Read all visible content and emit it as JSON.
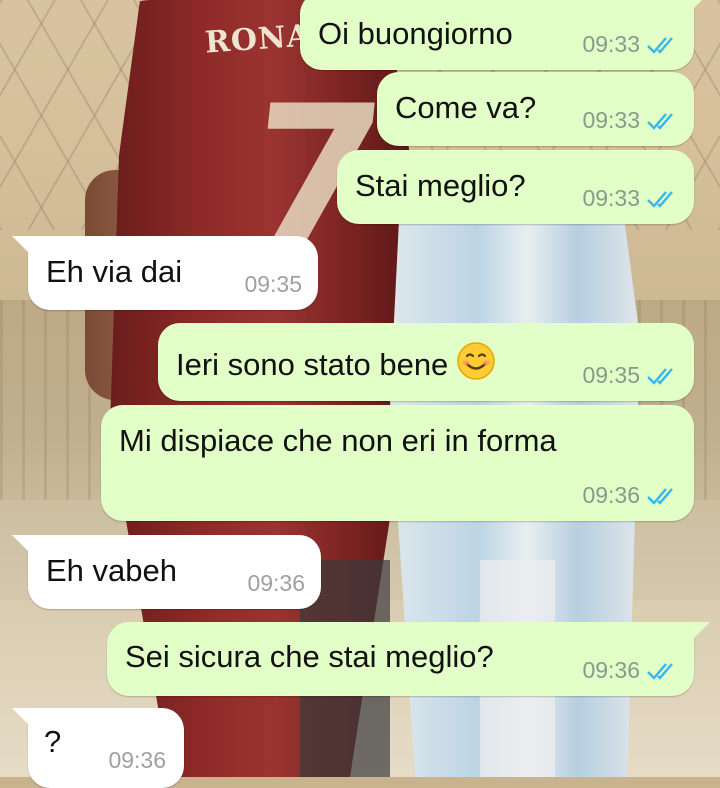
{
  "wallpaper": {
    "jersey_name": "RONA",
    "jersey_number": "7"
  },
  "colors": {
    "outgoing_bubble": "#e2ffc7",
    "incoming_bubble": "#ffffff",
    "read_ticks": "#34b7f1"
  },
  "messages": [
    {
      "direction": "outgoing",
      "text": "Oi buongiorno",
      "time": "09:33",
      "status": "read"
    },
    {
      "direction": "outgoing",
      "text": "Come va?",
      "time": "09:33",
      "status": "read"
    },
    {
      "direction": "outgoing",
      "text": "Stai meglio?",
      "time": "09:33",
      "status": "read"
    },
    {
      "direction": "incoming",
      "text": "Eh via dai",
      "time": "09:35"
    },
    {
      "direction": "outgoing",
      "text": "Ieri sono stato bene",
      "emoji": "smiling-face-icon",
      "time": "09:35",
      "status": "read"
    },
    {
      "direction": "outgoing",
      "text": "Mi dispiace che non eri in forma",
      "time": "09:36",
      "status": "read"
    },
    {
      "direction": "incoming",
      "text": "Eh vabeh",
      "time": "09:36"
    },
    {
      "direction": "outgoing",
      "text": "Sei sicura che stai meglio?",
      "time": "09:36",
      "status": "read"
    },
    {
      "direction": "incoming",
      "text": "?",
      "time": "09:36"
    }
  ]
}
